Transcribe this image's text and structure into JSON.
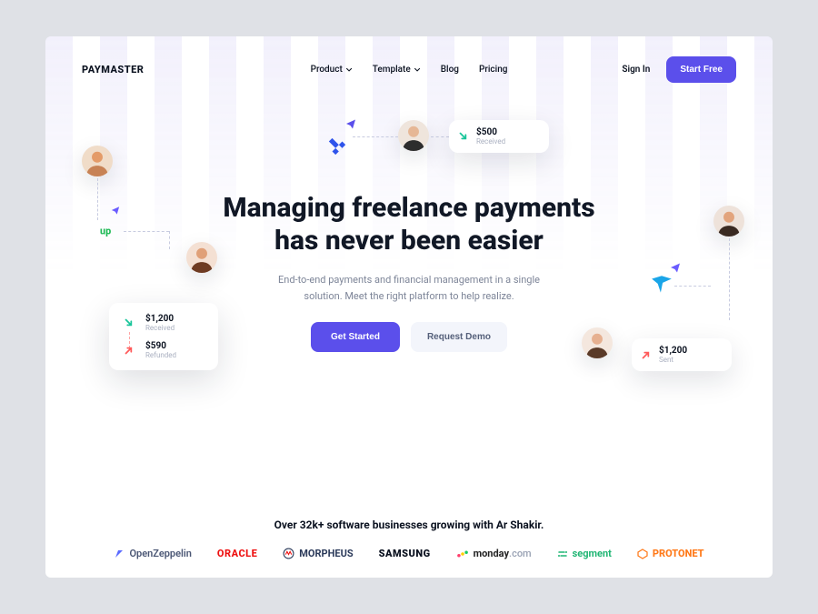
{
  "brand": "PAYMASTER",
  "nav": {
    "items": [
      "Product",
      "Template",
      "Blog",
      "Pricing"
    ],
    "signin": "Sign In",
    "cta": "Start Free"
  },
  "hero": {
    "title_l1": "Managing freelance payments",
    "title_l2": "has never been easier",
    "subtitle": "End-to-end payments and financial management in a single solution. Meet the right platform to help realize.",
    "primary": "Get Started",
    "secondary": "Request Demo"
  },
  "cards": {
    "top": {
      "amount": "$500",
      "label": "Received"
    },
    "left_a": {
      "amount": "$1,200",
      "label": "Received"
    },
    "left_b": {
      "amount": "$590",
      "label": "Refunded"
    },
    "right": {
      "amount": "$1,200",
      "label": "Sent"
    }
  },
  "social_caption": "Over 32k+ software businesses growing with Ar Shakir.",
  "brands": {
    "openzeppelin": "OpenZeppelin",
    "oracle": "ORACLE",
    "morpheus": "MORPHEUS",
    "samsung": "SAMSUNG",
    "monday": "monday",
    "monday_suffix": ".com",
    "segment": "segment",
    "protonet": "PROTONET"
  }
}
